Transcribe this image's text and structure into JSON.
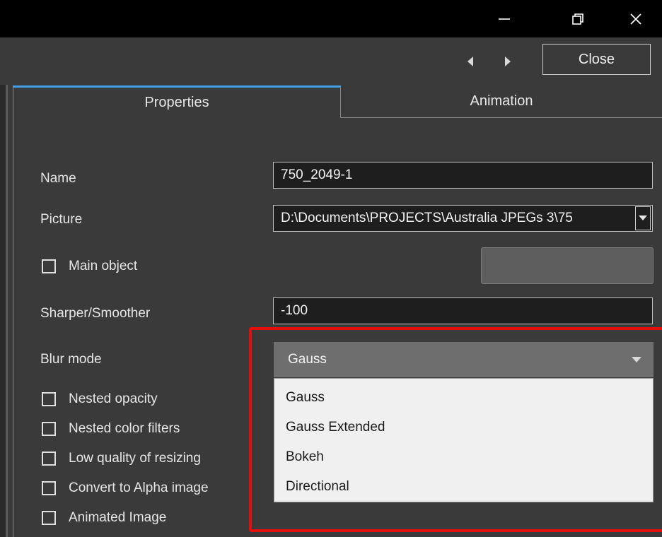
{
  "window": {
    "controls": {
      "minimize_icon": "minimize-icon",
      "restore_icon": "restore-icon",
      "close_icon": "close-icon"
    }
  },
  "toolbar": {
    "close_label": "Close"
  },
  "tabs": [
    {
      "label": "Properties",
      "active": true
    },
    {
      "label": "Animation",
      "active": false
    }
  ],
  "form": {
    "name_label": "Name",
    "name_value": "750_2049-1",
    "picture_label": "Picture",
    "picture_value": "D:\\Documents\\PROJECTS\\Australia JPEGs 3\\75",
    "main_object_label": "Main object",
    "sharper_label": "Sharper/Smoother",
    "sharper_value": "-100",
    "blur_mode_label": "Blur mode",
    "blur_mode_value": "Gauss",
    "blur_mode_options": [
      "Gauss",
      "Gauss Extended",
      "Bokeh",
      "Directional"
    ],
    "checkboxes": [
      {
        "label": "Nested opacity",
        "checked": false
      },
      {
        "label": "Nested color filters",
        "checked": false
      },
      {
        "label": "Low quality of resizing",
        "checked": false
      },
      {
        "label": "Convert to Alpha image",
        "checked": false
      },
      {
        "label": "Animated Image",
        "checked": false
      }
    ]
  },
  "colors": {
    "tab_accent": "#3ea0e8",
    "highlight_box": "#e01010",
    "background": "#3a3a3a",
    "titlebar": "#000000"
  }
}
